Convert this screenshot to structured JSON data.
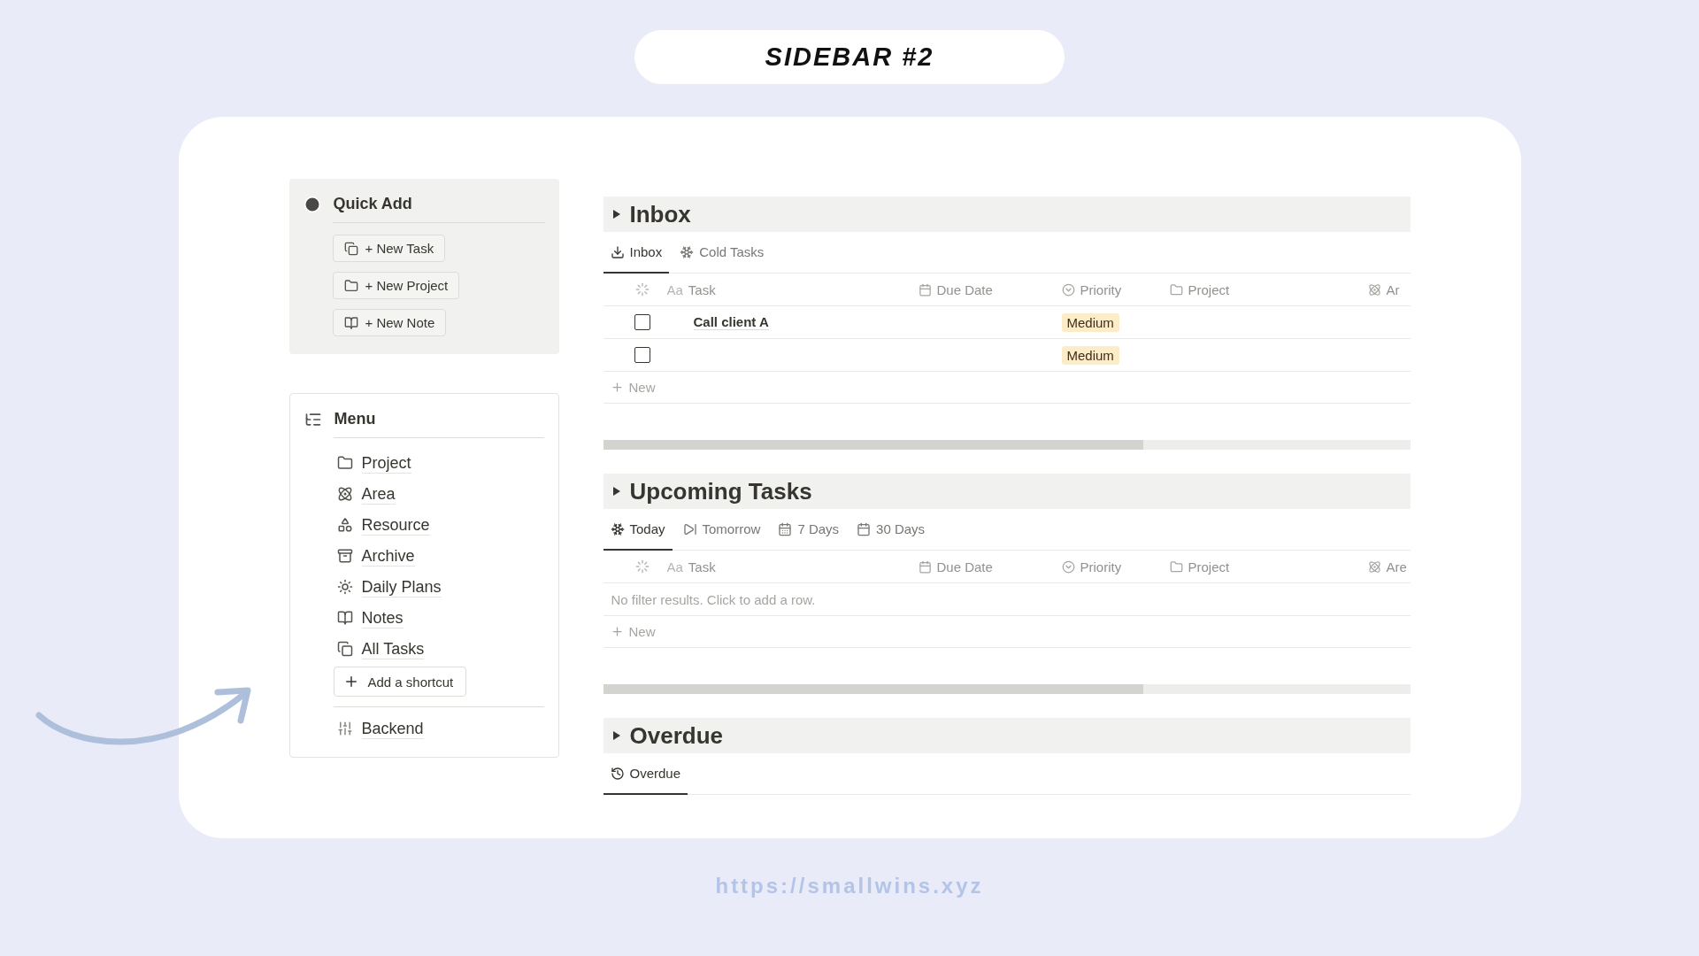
{
  "banner": {
    "title": "SIDEBAR #2"
  },
  "quick_add": {
    "title": "Quick Add",
    "buttons": [
      "+ New Task",
      "+ New Project",
      "+ New Note"
    ]
  },
  "menu": {
    "title": "Menu",
    "items": [
      "Project",
      "Area",
      "Resource",
      "Archive",
      "Daily Plans",
      "Notes",
      "All Tasks"
    ],
    "add_button": "Add a shortcut",
    "footer_item": "Backend"
  },
  "sections": [
    {
      "title": "Inbox",
      "tabs": [
        {
          "label": "Inbox",
          "selected": true
        },
        {
          "label": "Cold Tasks",
          "selected": false
        }
      ],
      "table": {
        "columns": [
          {
            "glyph": "Aa",
            "label": "Task"
          },
          {
            "label": "Due Date"
          },
          {
            "label": "Priority"
          },
          {
            "label": "Project"
          },
          {
            "label": "Ar"
          }
        ],
        "rows": [
          {
            "checked": false,
            "task": "Call client A",
            "priority": "Medium"
          },
          {
            "checked": false,
            "priority": "Medium"
          }
        ],
        "new_label": "New"
      }
    },
    {
      "title": "Upcoming Tasks",
      "tabs": [
        {
          "label": "Today",
          "selected": true
        },
        {
          "label": "Tomorrow",
          "selected": false
        },
        {
          "label": "7 Days",
          "selected": false
        },
        {
          "label": "30 Days",
          "selected": false
        }
      ],
      "table": {
        "columns": [
          {
            "glyph": "Aa",
            "label": "Task"
          },
          {
            "label": "Due Date"
          },
          {
            "label": "Priority"
          },
          {
            "label": "Project"
          },
          {
            "label": "Are"
          }
        ],
        "empty_text": "No filter results. Click to add a row.",
        "new_label": "New"
      }
    },
    {
      "title": "Overdue",
      "tabs": [
        {
          "label": "Overdue",
          "selected": true
        }
      ]
    }
  ],
  "footer": {
    "url": "https://smallwins.xyz"
  }
}
